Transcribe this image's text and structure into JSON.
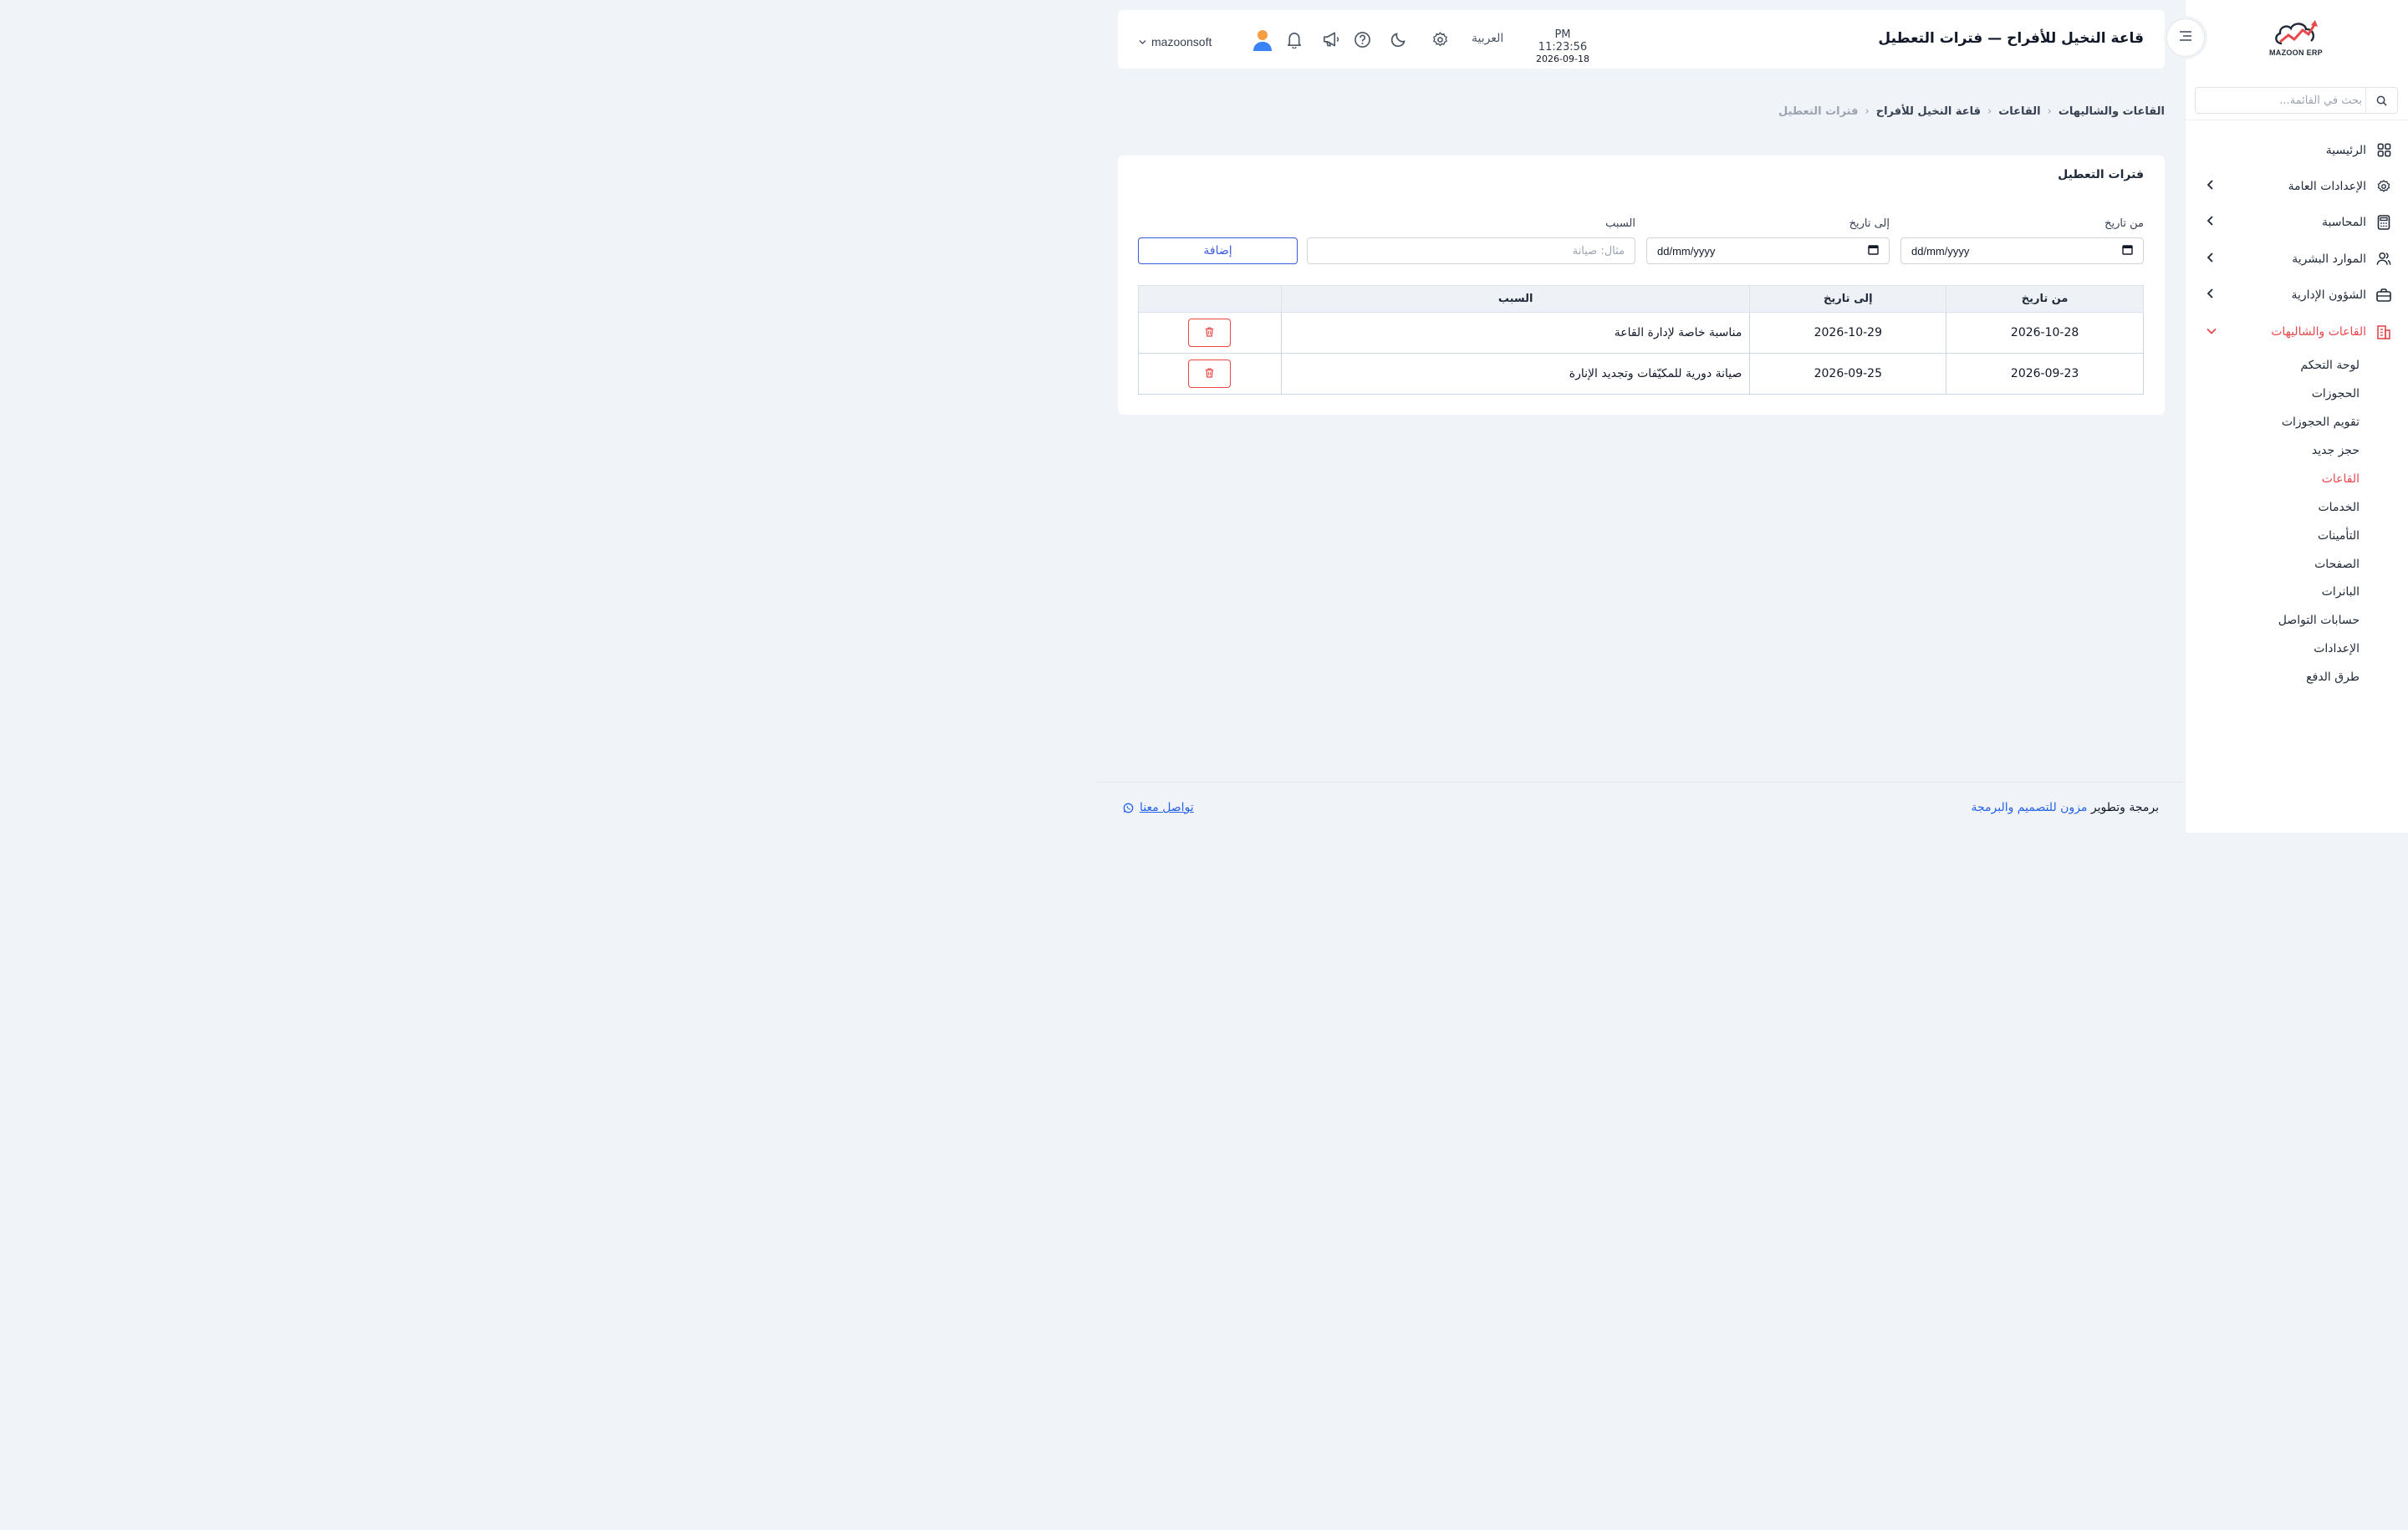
{
  "brand": {
    "logo_text": "MAZOON ERP"
  },
  "sidebar": {
    "search_placeholder": "بحث في القائمة...",
    "items": [
      {
        "label": "الرئيسية",
        "icon": "grid-icon",
        "has_children": false
      },
      {
        "label": "الإعدادات العامة",
        "icon": "gear-icon",
        "has_children": true
      },
      {
        "label": "المحاسبة",
        "icon": "calculator-icon",
        "has_children": true
      },
      {
        "label": "الموارد البشرية",
        "icon": "users-icon",
        "has_children": true
      },
      {
        "label": "الشؤون الإدارية",
        "icon": "briefcase-icon",
        "has_children": true
      },
      {
        "label": "القاعات والشاليهات",
        "icon": "building-icon",
        "has_children": true,
        "expanded": true,
        "active": true
      }
    ],
    "sub_items": [
      {
        "label": "لوحة التحكم"
      },
      {
        "label": "الحجوزات"
      },
      {
        "label": "تقويم الحجوزات"
      },
      {
        "label": "حجز جديد"
      },
      {
        "label": "القاعات",
        "active": true
      },
      {
        "label": "الخدمات"
      },
      {
        "label": "التأمينات"
      },
      {
        "label": "الصفحات"
      },
      {
        "label": "البانرات"
      },
      {
        "label": "حسابات التواصل"
      },
      {
        "label": "الإعدادات"
      },
      {
        "label": "طرق الدفع"
      }
    ]
  },
  "header": {
    "title": "قاعة النخيل للأفراح — فترات التعطيل",
    "time": "PM 11:23:56",
    "date": "2026-09-18",
    "language": "العربية",
    "username": "mazoonsoft"
  },
  "breadcrumb": [
    "القاعات والشاليهات",
    "القاعات",
    "قاعة النخيل للأفراح",
    "فترات التعطيل"
  ],
  "card": {
    "title": "فترات التعطيل",
    "form": {
      "from_label": "من تاريخ",
      "to_label": "إلى تاريخ",
      "reason_label": "السبب",
      "date_placeholder": "dd/mm/yyyy",
      "reason_placeholder": "مثال: صيانة",
      "add_button": "إضافة"
    },
    "table": {
      "columns": [
        "من تاريخ",
        "إلى تاريخ",
        "السبب",
        ""
      ],
      "rows": [
        {
          "from": "2026-10-28",
          "to": "2026-10-29",
          "reason": "مناسبة خاصة لإدارة القاعة"
        },
        {
          "from": "2026-09-23",
          "to": "2026-09-25",
          "reason": "صيانة دورية للمكيّفات وتجديد الإنارة"
        }
      ]
    }
  },
  "footer": {
    "credit_prefix": "برمجة وتطوير",
    "credit_link": "مزون للتصميم والبرمجة",
    "contact": "تواصل معنا"
  },
  "colors": {
    "accent": "#e5484d",
    "primary": "#3b5bdb",
    "link": "#2563eb",
    "background": "#f0f3f7"
  }
}
